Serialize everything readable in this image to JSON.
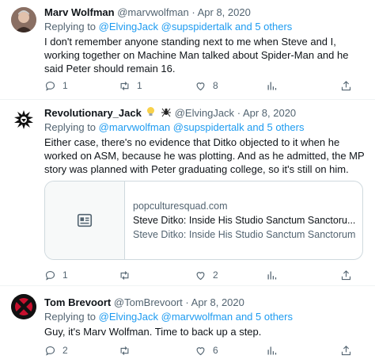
{
  "tweets": [
    {
      "display_name": "Marv Wolfman",
      "handle": "@marvwolfman",
      "date": "Apr 8, 2020",
      "replying_prefix": "Replying to",
      "replying_mentions": "@ElvingJack @supspidertalk and 5 others",
      "text": "I don't remember anyone standing next to me when Steve and I, working together on Machine Man talked about Spider-Man and he said Peter should remain 16.",
      "actions": {
        "replies": "1",
        "retweets": "1",
        "likes": "8",
        "views": ""
      }
    },
    {
      "display_name": "Revolutionary_Jack",
      "handle": "@ElvingJack",
      "date": "Apr 8, 2020",
      "replying_prefix": "Replying to",
      "replying_mentions": "@marvwolfman @supspidertalk and 5 others",
      "text": "Either case, there's no evidence that Ditko objected to it when he worked on ASM, because he was plotting. And as he admitted, the MP story was planned with Peter graduating college, so it's still on him.",
      "card": {
        "domain": "popculturesquad.com",
        "title": "Steve Ditko: Inside His Studio Sanctum Sanctoru...",
        "description": "Steve Ditko: Inside His Studio Sanctum Sanctorum"
      },
      "actions": {
        "replies": "1",
        "retweets": "",
        "likes": "2",
        "views": ""
      }
    },
    {
      "display_name": "Tom Brevoort",
      "handle": "@TomBrevoort",
      "date": "Apr 8, 2020",
      "replying_prefix": "Replying to",
      "replying_mentions": "@ElvingJack @marvwolfman and 5 others",
      "text": "Guy, it's Marv Wolfman. Time to back up a step.",
      "actions": {
        "replies": "2",
        "retweets": "",
        "likes": "6",
        "views": ""
      }
    }
  ],
  "separator": "·",
  "colors": {
    "link": "#1d9bf0",
    "secondary": "#536471",
    "text": "#0f1419",
    "border": "#cfd9de"
  },
  "icons": [
    "reply-icon",
    "retweet-icon",
    "like-icon",
    "views-icon",
    "share-icon",
    "article-icon",
    "lightbulb-emoji",
    "spider-emoji"
  ]
}
